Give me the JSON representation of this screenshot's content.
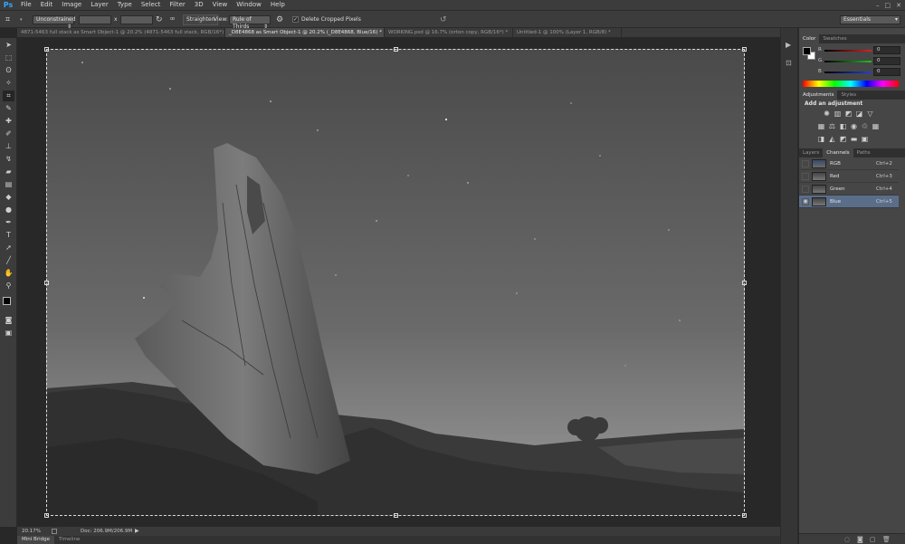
{
  "app": {
    "logo": "Ps"
  },
  "menu": [
    "File",
    "Edit",
    "Image",
    "Layer",
    "Type",
    "Select",
    "Filter",
    "3D",
    "View",
    "Window",
    "Help"
  ],
  "window_controls": {
    "minimize": "–",
    "maximize": "□",
    "close": "✕"
  },
  "options": {
    "ratio_value": "Unconstrained",
    "swap_glyph": "x",
    "straighten": "Straighten",
    "view_label": "View:",
    "view_value": "Rule of Thirds",
    "delete_cropped": "Delete Cropped Pixels",
    "workspace": "Essentials",
    "crop_tool": "crop-icon"
  },
  "tabs": [
    {
      "label": "4871-5463 full stack as Smart Object-1 @ 20.2% (4871-5463 full stack, RGB/16*) *",
      "active": false
    },
    {
      "label": "_D8E4868 as Smart Object-1 @ 20.2% (_D8E4868, Blue/16) *",
      "active": true
    },
    {
      "label": "WORKING.psd @ 16.7% (orton copy, RGB/16*) *",
      "active": false
    },
    {
      "label": "Untitled-1 @ 100% (Layer 1, RGB/8) *",
      "active": false
    }
  ],
  "status": {
    "zoom": "20.17%",
    "doc": "Doc: 206.9M/206.9M"
  },
  "bottom_tabs": [
    "Mini Bridge",
    "Timeline"
  ],
  "color_panel": {
    "tabs": [
      "Color",
      "Swatches"
    ],
    "sliders": [
      {
        "label": "R",
        "value": "0",
        "color": "#e02020"
      },
      {
        "label": "G",
        "value": "0",
        "color": "#20c020"
      },
      {
        "label": "B",
        "value": "0",
        "color": "#2040e0"
      }
    ]
  },
  "adjustments_panel": {
    "tabs": [
      "Adjustments",
      "Styles"
    ],
    "heading": "Add an adjustment"
  },
  "channels_panel": {
    "tabs": [
      "Layers",
      "Channels",
      "Paths"
    ],
    "channels": [
      {
        "name": "RGB",
        "shortcut": "Ctrl+2",
        "selected": false
      },
      {
        "name": "Red",
        "shortcut": "Ctrl+3",
        "selected": false
      },
      {
        "name": "Green",
        "shortcut": "Ctrl+4",
        "selected": false
      },
      {
        "name": "Blue",
        "shortcut": "Ctrl+5",
        "selected": true
      }
    ]
  }
}
